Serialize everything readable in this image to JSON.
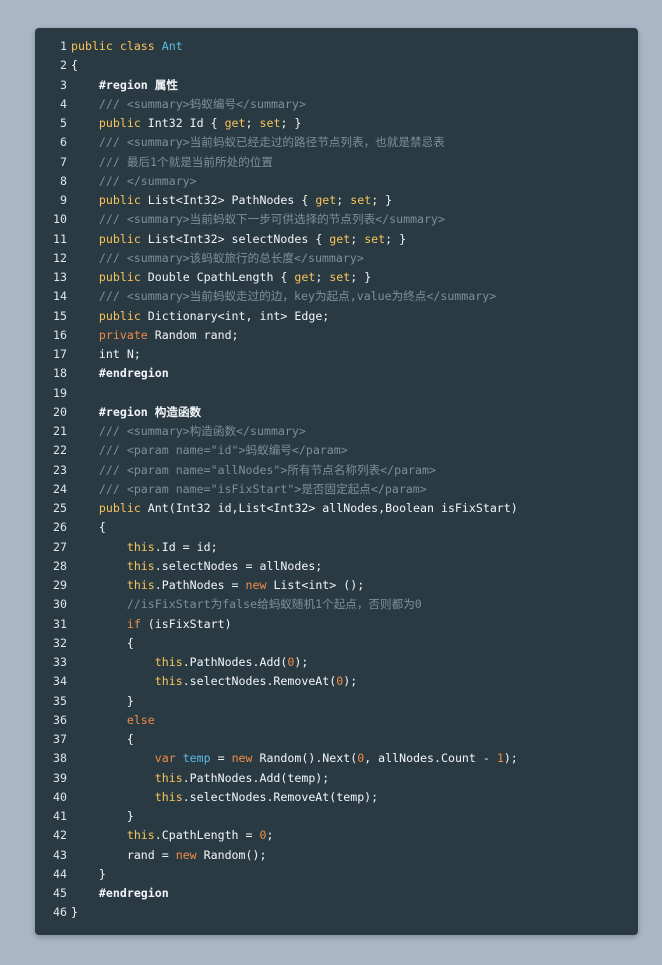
{
  "lines": [
    {
      "n": "1",
      "indent": 0,
      "tokens": [
        [
          "kw",
          "public class "
        ],
        [
          "cls",
          "Ant"
        ]
      ]
    },
    {
      "n": "2",
      "indent": 0,
      "tokens": [
        [
          "type",
          "{"
        ]
      ]
    },
    {
      "n": "3",
      "indent": 1,
      "tokens": [
        [
          "region",
          "#region 属性"
        ]
      ]
    },
    {
      "n": "4",
      "indent": 1,
      "tokens": [
        [
          "cm",
          "/// <summary>蚂蚁编号</summary>"
        ]
      ]
    },
    {
      "n": "5",
      "indent": 1,
      "tokens": [
        [
          "kw",
          "public "
        ],
        [
          "type",
          "Int32 Id { "
        ],
        [
          "kw",
          "get"
        ],
        [
          "type",
          "; "
        ],
        [
          "kw",
          "set"
        ],
        [
          "type",
          "; }"
        ]
      ]
    },
    {
      "n": "6",
      "indent": 1,
      "tokens": [
        [
          "cm",
          "/// <summary>当前蚂蚁已经走过的路径节点列表，也就是禁忌表"
        ]
      ]
    },
    {
      "n": "7",
      "indent": 1,
      "tokens": [
        [
          "cm",
          "/// 最后1个就是当前所处的位置"
        ]
      ]
    },
    {
      "n": "8",
      "indent": 1,
      "tokens": [
        [
          "cm",
          "/// </summary>"
        ]
      ]
    },
    {
      "n": "9",
      "indent": 1,
      "tokens": [
        [
          "kw",
          "public "
        ],
        [
          "type",
          "List<Int32> PathNodes { "
        ],
        [
          "kw",
          "get"
        ],
        [
          "type",
          "; "
        ],
        [
          "kw",
          "set"
        ],
        [
          "type",
          "; }"
        ]
      ]
    },
    {
      "n": "10",
      "indent": 1,
      "tokens": [
        [
          "cm",
          "/// <summary>当前蚂蚁下一步可供选择的节点列表</summary>"
        ]
      ]
    },
    {
      "n": "11",
      "indent": 1,
      "tokens": [
        [
          "kw",
          "public "
        ],
        [
          "type",
          "List<Int32> selectNodes { "
        ],
        [
          "kw",
          "get"
        ],
        [
          "type",
          "; "
        ],
        [
          "kw",
          "set"
        ],
        [
          "type",
          "; }"
        ]
      ]
    },
    {
      "n": "12",
      "indent": 1,
      "tokens": [
        [
          "cm",
          "/// <summary>该蚂蚁旅行的总长度</summary>"
        ]
      ]
    },
    {
      "n": "13",
      "indent": 1,
      "tokens": [
        [
          "kw",
          "public "
        ],
        [
          "type",
          "Double CpathLength { "
        ],
        [
          "kw",
          "get"
        ],
        [
          "type",
          "; "
        ],
        [
          "kw",
          "set"
        ],
        [
          "type",
          "; }"
        ]
      ]
    },
    {
      "n": "14",
      "indent": 1,
      "tokens": [
        [
          "cm",
          "/// <summary>当前蚂蚁走过的边，key为起点,value为终点</summary>"
        ]
      ]
    },
    {
      "n": "15",
      "indent": 1,
      "tokens": [
        [
          "kw",
          "public "
        ],
        [
          "type",
          "Dictionary<int, int> Edge;"
        ]
      ]
    },
    {
      "n": "16",
      "indent": 1,
      "tokens": [
        [
          "kw2",
          "private "
        ],
        [
          "type",
          "Random rand;"
        ]
      ]
    },
    {
      "n": "17",
      "indent": 1,
      "tokens": [
        [
          "type",
          "int N;"
        ]
      ]
    },
    {
      "n": "18",
      "indent": 1,
      "tokens": [
        [
          "region",
          "#endregion"
        ]
      ]
    },
    {
      "n": "19",
      "indent": 0,
      "tokens": []
    },
    {
      "n": "20",
      "indent": 1,
      "tokens": [
        [
          "region",
          "#region 构造函数"
        ]
      ]
    },
    {
      "n": "21",
      "indent": 1,
      "tokens": [
        [
          "cm",
          "/// <summary>构造函数</summary>"
        ]
      ]
    },
    {
      "n": "22",
      "indent": 1,
      "tokens": [
        [
          "cm",
          "/// <param name=\"id\">蚂蚁编号</param>"
        ]
      ]
    },
    {
      "n": "23",
      "indent": 1,
      "tokens": [
        [
          "cm",
          "/// <param name=\"allNodes\">所有节点名称列表</param>"
        ]
      ]
    },
    {
      "n": "24",
      "indent": 1,
      "tokens": [
        [
          "cm",
          "/// <param name=\"isFixStart\">是否固定起点</param>"
        ]
      ]
    },
    {
      "n": "25",
      "indent": 1,
      "tokens": [
        [
          "kw",
          "public "
        ],
        [
          "type",
          "Ant(Int32 id,List<Int32> allNodes,Boolean isFixStart)"
        ]
      ]
    },
    {
      "n": "26",
      "indent": 1,
      "tokens": [
        [
          "type",
          "{"
        ]
      ]
    },
    {
      "n": "27",
      "indent": 2,
      "tokens": [
        [
          "kw",
          "this"
        ],
        [
          "type",
          ".Id = id;"
        ]
      ]
    },
    {
      "n": "28",
      "indent": 2,
      "tokens": [
        [
          "kw",
          "this"
        ],
        [
          "type",
          ".selectNodes = allNodes;"
        ]
      ]
    },
    {
      "n": "29",
      "indent": 2,
      "tokens": [
        [
          "kw",
          "this"
        ],
        [
          "type",
          ".PathNodes = "
        ],
        [
          "kw2",
          "new "
        ],
        [
          "type",
          "List<int> ();"
        ]
      ]
    },
    {
      "n": "30",
      "indent": 2,
      "tokens": [
        [
          "cm",
          "//isFixStart为false给蚂蚁随机1个起点，否则都为0"
        ]
      ]
    },
    {
      "n": "31",
      "indent": 2,
      "tokens": [
        [
          "kw2",
          "if "
        ],
        [
          "type",
          "(isFixStart)"
        ]
      ]
    },
    {
      "n": "32",
      "indent": 2,
      "tokens": [
        [
          "type",
          "{"
        ]
      ]
    },
    {
      "n": "33",
      "indent": 3,
      "tokens": [
        [
          "kw",
          "this"
        ],
        [
          "type",
          ".PathNodes.Add("
        ],
        [
          "num",
          "0"
        ],
        [
          "type",
          ");"
        ]
      ]
    },
    {
      "n": "34",
      "indent": 3,
      "tokens": [
        [
          "kw",
          "this"
        ],
        [
          "type",
          ".selectNodes.RemoveAt("
        ],
        [
          "num",
          "0"
        ],
        [
          "type",
          ");"
        ]
      ]
    },
    {
      "n": "35",
      "indent": 2,
      "tokens": [
        [
          "type",
          "}"
        ]
      ]
    },
    {
      "n": "36",
      "indent": 2,
      "tokens": [
        [
          "kw2",
          "else"
        ]
      ]
    },
    {
      "n": "37",
      "indent": 2,
      "tokens": [
        [
          "type",
          "{"
        ]
      ]
    },
    {
      "n": "38",
      "indent": 3,
      "tokens": [
        [
          "kw2",
          "var "
        ],
        [
          "cls",
          "temp"
        ],
        [
          "type",
          " = "
        ],
        [
          "kw2",
          "new "
        ],
        [
          "type",
          "Random().Next("
        ],
        [
          "num",
          "0"
        ],
        [
          "type",
          ", allNodes.Count - "
        ],
        [
          "num",
          "1"
        ],
        [
          "type",
          ");"
        ]
      ]
    },
    {
      "n": "39",
      "indent": 3,
      "tokens": [
        [
          "kw",
          "this"
        ],
        [
          "type",
          ".PathNodes.Add(temp);"
        ]
      ]
    },
    {
      "n": "40",
      "indent": 3,
      "tokens": [
        [
          "kw",
          "this"
        ],
        [
          "type",
          ".selectNodes.RemoveAt(temp);"
        ]
      ]
    },
    {
      "n": "41",
      "indent": 2,
      "tokens": [
        [
          "type",
          "}"
        ]
      ]
    },
    {
      "n": "42",
      "indent": 2,
      "tokens": [
        [
          "kw",
          "this"
        ],
        [
          "type",
          ".CpathLength = "
        ],
        [
          "num",
          "0"
        ],
        [
          "type",
          ";"
        ]
      ]
    },
    {
      "n": "43",
      "indent": 2,
      "tokens": [
        [
          "type",
          "rand = "
        ],
        [
          "kw2",
          "new "
        ],
        [
          "type",
          "Random();"
        ]
      ]
    },
    {
      "n": "44",
      "indent": 1,
      "tokens": [
        [
          "type",
          "}"
        ]
      ]
    },
    {
      "n": "45",
      "indent": 1,
      "tokens": [
        [
          "region",
          "#endregion"
        ]
      ]
    },
    {
      "n": "46",
      "indent": 0,
      "tokens": [
        [
          "type",
          "}"
        ]
      ]
    }
  ]
}
